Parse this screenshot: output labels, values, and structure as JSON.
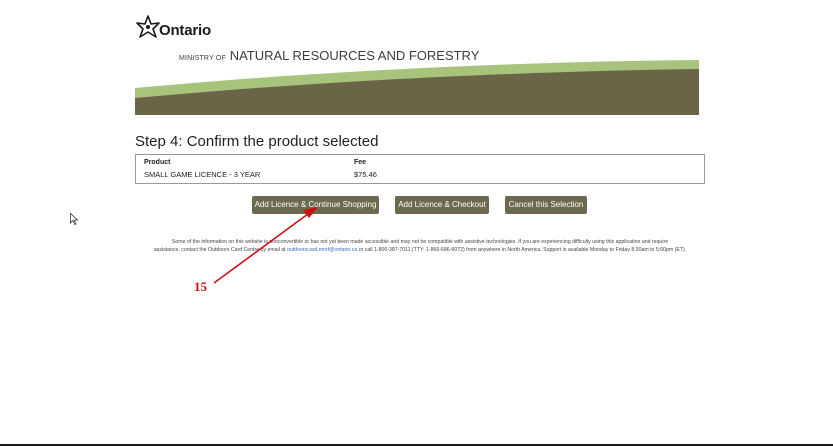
{
  "header": {
    "brand": "Ontario",
    "ministry_prefix": "MINISTRY OF",
    "ministry_name": "NATURAL RESOURCES AND FORESTRY",
    "colors": {
      "banner_dark": "#6b6547",
      "banner_light": "#a8c47c"
    }
  },
  "step_title": "Step 4: Confirm the product selected",
  "product_table": {
    "columns": [
      "Product",
      "Fee"
    ],
    "rows": [
      {
        "product": "SMALL GAME LICENCE - 3 YEAR",
        "fee": "$75.46"
      }
    ]
  },
  "buttons": {
    "continue_shopping": "Add Licence & Continue Shopping",
    "checkout": "Add Licence & Checkout",
    "cancel": "Cancel this Selection",
    "color": "#6b6a4e"
  },
  "notice": {
    "line1": "Some of the information on this website is nonconvertible or has not yet been made accessible and may not be compatible with assistive technologies. If you are experiencing difficulty using this application and require",
    "line2_prefix": "assistance, contact the Outdoors Card Centre by email at",
    "email": "outdoorscard.mnrf@ontario.ca",
    "line2_suffix": "or call 1-800-387-7011 (TTY: 1-866-686-6072) from anywhere in North America. Support is available Monday to Friday 8:30am to 5:00pm (ET)."
  },
  "annotation": {
    "label": "15",
    "color": "#cc1111"
  }
}
